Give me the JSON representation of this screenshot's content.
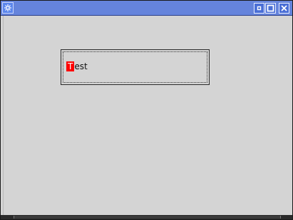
{
  "window": {
    "title": ""
  },
  "button": {
    "label_first": "T",
    "label_rest": "est"
  },
  "colors": {
    "titlebar": "#4a6fd6",
    "background": "#d4d4d4",
    "mnemonic_highlight": "#ff0000"
  },
  "icons": {
    "system_menu": "system-menu-icon",
    "minimize": "minimize-icon",
    "maximize": "maximize-icon",
    "close": "close-icon"
  }
}
